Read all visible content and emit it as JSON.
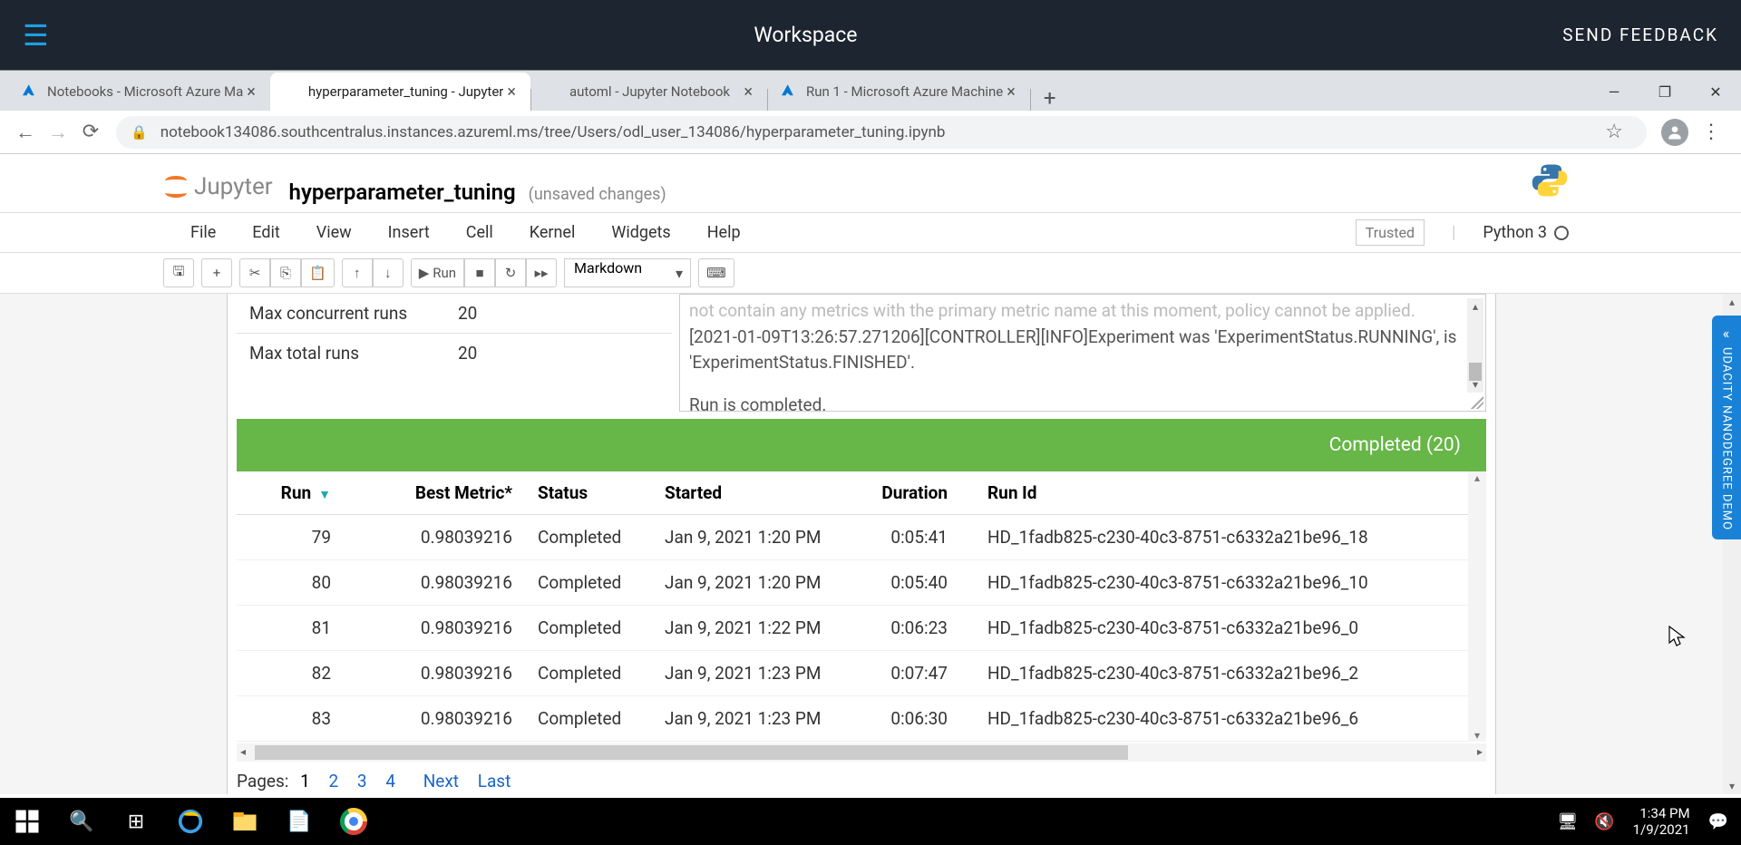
{
  "workspace": {
    "title": "Workspace",
    "feedback": "SEND FEEDBACK"
  },
  "tabs": [
    {
      "title": "Notebooks - Microsoft Azure Ma",
      "type": "azure"
    },
    {
      "title": "hyperparameter_tuning - Jupyter",
      "type": "jupyter"
    },
    {
      "title": "automl - Jupyter Notebook",
      "type": "jupyter"
    },
    {
      "title": "Run 1 - Microsoft Azure Machine",
      "type": "azure"
    }
  ],
  "url": "notebook134086.southcentralus.instances.azureml.ms/tree/Users/odl_user_134086/hyperparameter_tuning.ipynb",
  "jupyter": {
    "logo": "Jupyter",
    "name": "hyperparameter_tuning",
    "status": "(unsaved changes)",
    "menu": [
      "File",
      "Edit",
      "View",
      "Insert",
      "Cell",
      "Kernel",
      "Widgets",
      "Help"
    ],
    "trusted": "Trusted",
    "kernel": "Python 3",
    "run_label": "Run",
    "cell_type": "Markdown"
  },
  "params": [
    {
      "k": "Max concurrent runs",
      "v": "20"
    },
    {
      "k": "Max total runs",
      "v": "20"
    }
  ],
  "log": {
    "line0": "not contain any metrics with the primary metric name at this moment, policy cannot be applied.",
    "line1": "[2021-01-09T13:26:57.271206][CONTROLLER][INFO]Experiment was 'ExperimentStatus.RUNNING', is 'ExperimentStatus.FINISHED'.",
    "line2": "Run is completed."
  },
  "green_bar": "Completed (20)",
  "columns": {
    "run": "Run",
    "metric": "Best Metric*",
    "status": "Status",
    "started": "Started",
    "duration": "Duration",
    "runid": "Run Id"
  },
  "rows": [
    {
      "run": "79",
      "metric": "0.98039216",
      "status": "Completed",
      "started": "Jan 9, 2021 1:20 PM",
      "duration": "0:05:41",
      "runid": "HD_1fadb825-c230-40c3-8751-c6332a21be96_18"
    },
    {
      "run": "80",
      "metric": "0.98039216",
      "status": "Completed",
      "started": "Jan 9, 2021 1:20 PM",
      "duration": "0:05:40",
      "runid": "HD_1fadb825-c230-40c3-8751-c6332a21be96_10"
    },
    {
      "run": "81",
      "metric": "0.98039216",
      "status": "Completed",
      "started": "Jan 9, 2021 1:22 PM",
      "duration": "0:06:23",
      "runid": "HD_1fadb825-c230-40c3-8751-c6332a21be96_0"
    },
    {
      "run": "82",
      "metric": "0.98039216",
      "status": "Completed",
      "started": "Jan 9, 2021 1:23 PM",
      "duration": "0:07:47",
      "runid": "HD_1fadb825-c230-40c3-8751-c6332a21be96_2"
    },
    {
      "run": "83",
      "metric": "0.98039216",
      "status": "Completed",
      "started": "Jan 9, 2021 1:23 PM",
      "duration": "0:06:30",
      "runid": "HD_1fadb825-c230-40c3-8751-c6332a21be96_6"
    }
  ],
  "pager": {
    "label": "Pages:",
    "current": "1",
    "pages": [
      "2",
      "3",
      "4"
    ],
    "next": "Next",
    "last": "Last"
  },
  "side_tab": "UDACITY NANODEGREE DEMO",
  "clock": {
    "time": "1:34 PM",
    "date": "1/9/2021"
  }
}
